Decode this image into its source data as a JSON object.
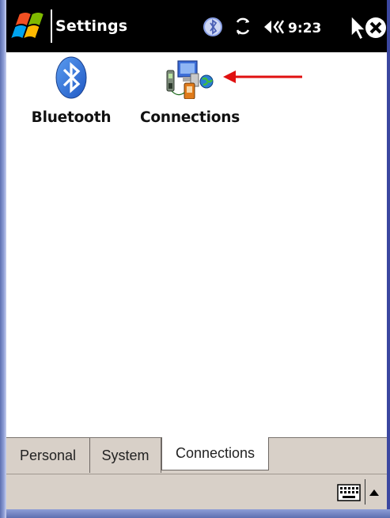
{
  "titlebar": {
    "title": "Settings",
    "clock": "9:23",
    "icons": [
      "start-menu-icon",
      "bluetooth-status-icon",
      "connectivity-icon",
      "volume-icon",
      "close-icon"
    ]
  },
  "content": {
    "items": [
      {
        "label": "Bluetooth",
        "icon": "bluetooth-icon"
      },
      {
        "label": "Connections",
        "icon": "connections-icon"
      }
    ],
    "annotation": "red-arrow-pointing-left",
    "colors": {
      "annotation": "#e01010",
      "bluetooth_blue": "#2f73d8"
    }
  },
  "tabs": [
    {
      "label": "Personal",
      "active": false
    },
    {
      "label": "System",
      "active": false
    },
    {
      "label": "Connections",
      "active": true
    }
  ],
  "commandbar": {
    "icons": [
      "keyboard-icon",
      "input-menu-arrow-icon"
    ]
  }
}
